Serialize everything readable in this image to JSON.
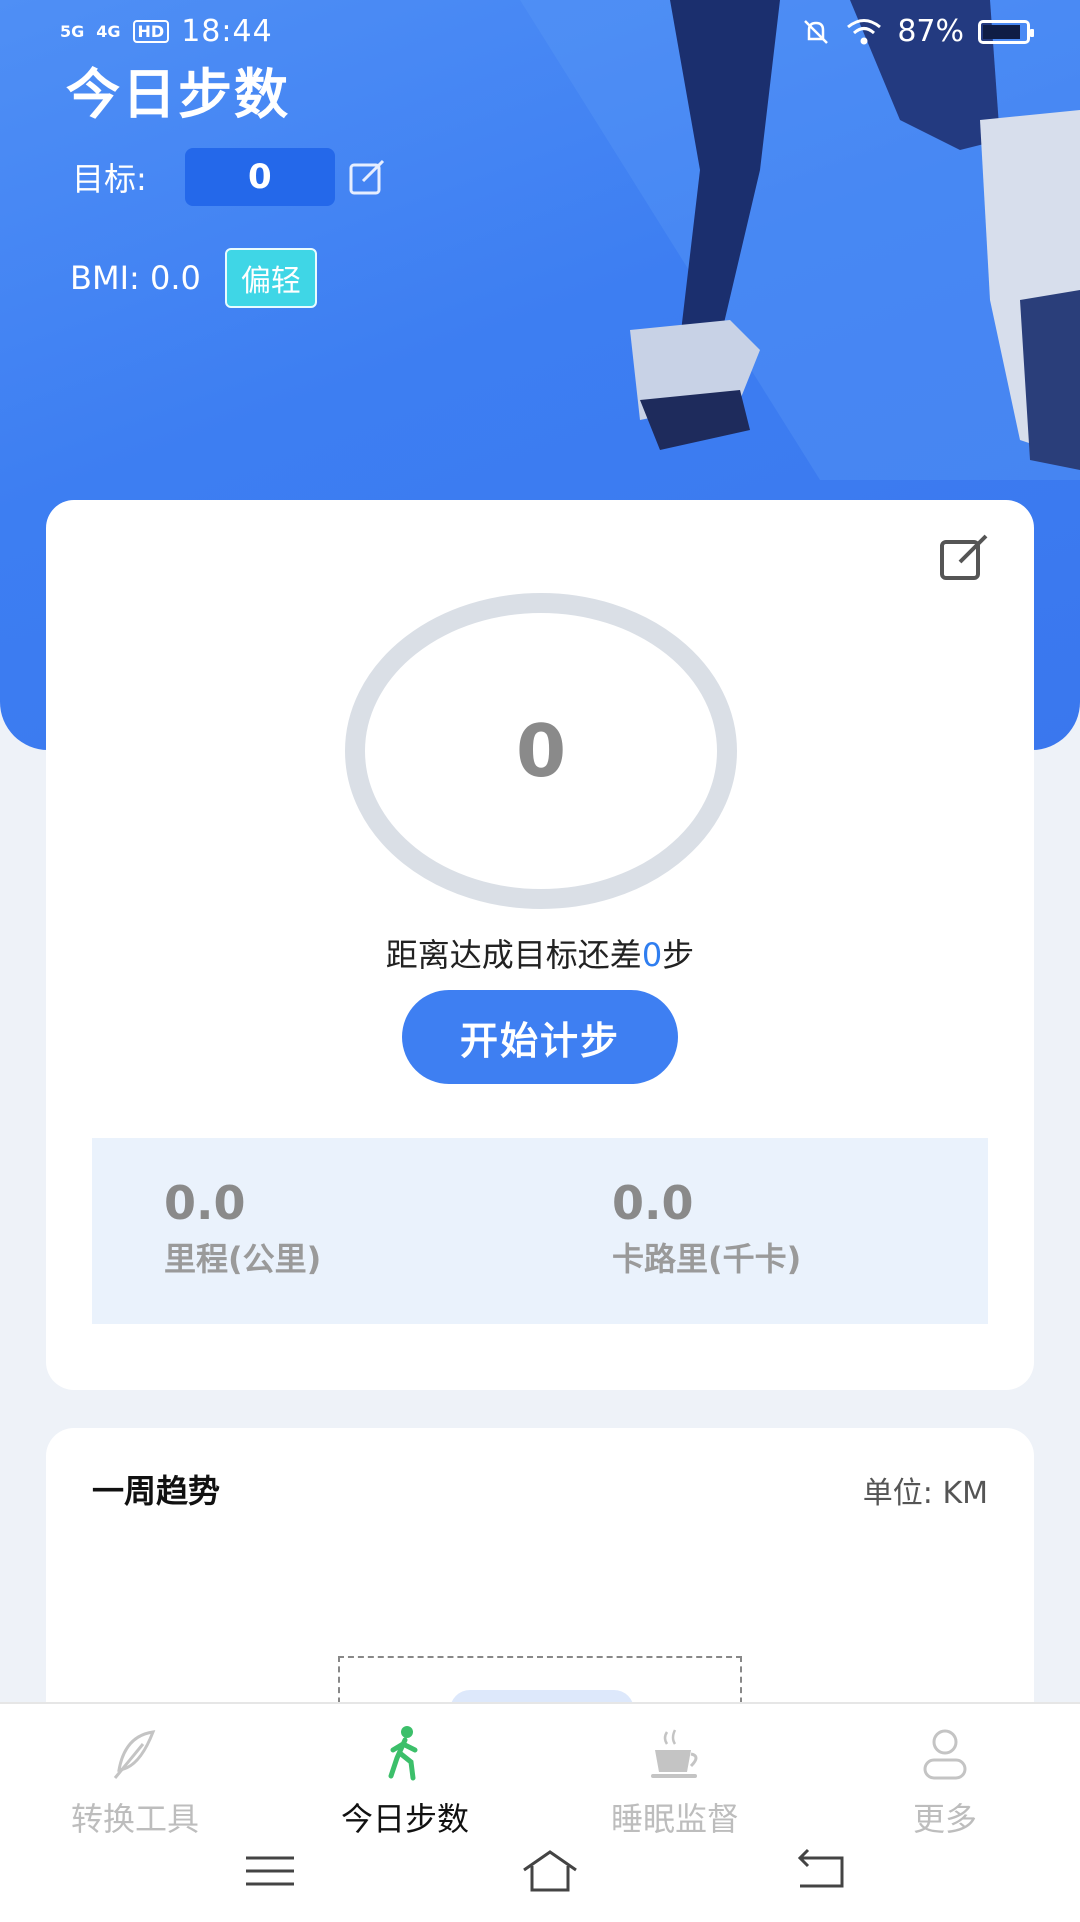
{
  "status_bar": {
    "signal1": "5G",
    "signal2": "4G",
    "hd": "HD",
    "time": "18:44",
    "battery": "87%",
    "battery_level": 0.87
  },
  "header": {
    "title": "今日步数",
    "goal_label": "目标:",
    "goal_value": "0",
    "bmi_label": "BMI: 0.0",
    "bmi_badge": "偏轻"
  },
  "main_card": {
    "steps_value": "0",
    "remain_prefix": "距离达成目标还差",
    "remain_value": "0",
    "remain_suffix": "步",
    "start_button": "开始计步",
    "stats": [
      {
        "value": "0.0",
        "label": "里程(公里)"
      },
      {
        "value": "0.0",
        "label": "卡路里(千卡)"
      }
    ]
  },
  "week_card": {
    "title": "一周趋势",
    "unit": "单位: KM"
  },
  "tabbar": {
    "tabs": [
      {
        "label": "转换工具",
        "icon": "feather-icon"
      },
      {
        "label": "今日步数",
        "icon": "walking-person-icon"
      },
      {
        "label": "睡眠监督",
        "icon": "coffee-cup-icon"
      },
      {
        "label": "更多",
        "icon": "person-icon"
      }
    ],
    "active_index": 1
  },
  "colors": {
    "brand_blue": "#3e7ff2",
    "badge_cyan": "#3fd6e6",
    "active_tab_icon": "#3cbf6a"
  }
}
